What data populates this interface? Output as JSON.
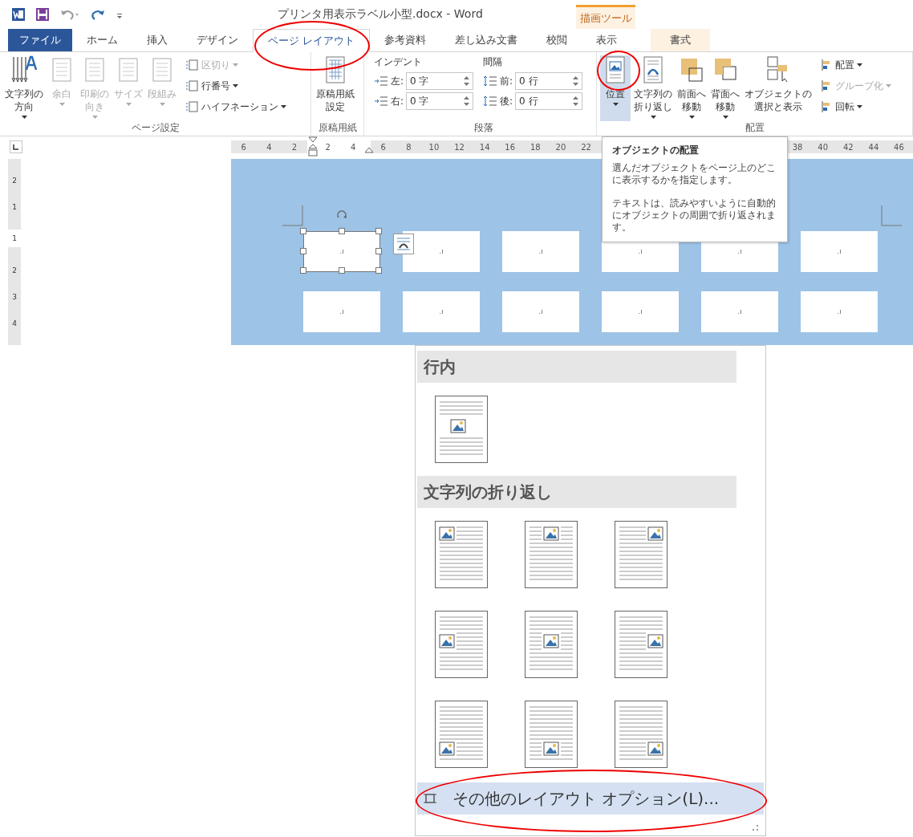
{
  "window": {
    "title": "プリンタ用表示ラベル小型.docx - Word",
    "contextual_group": "描画ツール"
  },
  "tabs": [
    {
      "label": "ファイル",
      "kind": "file",
      "selected": false,
      "circled": false
    },
    {
      "label": "ホーム",
      "kind": "tab",
      "selected": false,
      "circled": false
    },
    {
      "label": "挿入",
      "kind": "tab",
      "selected": false,
      "circled": false
    },
    {
      "label": "デザイン",
      "kind": "tab",
      "selected": false,
      "circled": false
    },
    {
      "label": "ページ レイアウト",
      "kind": "tab",
      "selected": true,
      "circled": true
    },
    {
      "label": "参考資料",
      "kind": "tab",
      "selected": false,
      "circled": false
    },
    {
      "label": "差し込み文書",
      "kind": "tab",
      "selected": false,
      "circled": false
    },
    {
      "label": "校閲",
      "kind": "tab",
      "selected": false,
      "circled": false
    },
    {
      "label": "表示",
      "kind": "tab",
      "selected": false,
      "circled": false
    },
    {
      "label": "書式",
      "kind": "contextual",
      "selected": false,
      "circled": false
    }
  ],
  "ribbon": {
    "page_setup": {
      "title": "ページ設定",
      "big_buttons": [
        {
          "lines": [
            "文字列の",
            "方向"
          ],
          "menu": true,
          "disabled": false
        },
        {
          "lines": [
            "余白"
          ],
          "menu": true,
          "disabled": true
        },
        {
          "lines": [
            "印刷の",
            "向き"
          ],
          "menu": true,
          "disabled": true
        },
        {
          "lines": [
            "サイズ"
          ],
          "menu": true,
          "disabled": true
        },
        {
          "lines": [
            "段組み"
          ],
          "menu": true,
          "disabled": true
        }
      ],
      "small_buttons": [
        {
          "label": "区切り",
          "menu": true,
          "disabled": true
        },
        {
          "label": "行番号",
          "menu": true,
          "disabled": false
        },
        {
          "label": "ハイフネーション",
          "menu": true,
          "disabled": false
        }
      ]
    },
    "manuscript": {
      "title": "原稿用紙",
      "button": {
        "lines": [
          "原稿用紙",
          "設定"
        ]
      }
    },
    "paragraph": {
      "title": "段落",
      "indent_label": "インデント",
      "spacing_label": "間隔",
      "indent": [
        {
          "label": "左:",
          "value": "0 字"
        },
        {
          "label": "右:",
          "value": "0 字"
        }
      ],
      "spacing": [
        {
          "label": "前:",
          "value": "0 行"
        },
        {
          "label": "後:",
          "value": "0 行"
        }
      ]
    },
    "arrange": {
      "title": "配置",
      "big_buttons": [
        {
          "lines": [
            "位置"
          ],
          "menu": true,
          "selected": true,
          "circled": true
        },
        {
          "lines": [
            "文字列の",
            "折り返し"
          ],
          "menu": true,
          "selected": false,
          "circled": false
        },
        {
          "lines": [
            "前面へ",
            "移動"
          ],
          "menu": true,
          "selected": false,
          "circled": false
        },
        {
          "lines": [
            "背面へ",
            "移動"
          ],
          "menu": true,
          "selected": false,
          "circled": false
        },
        {
          "lines": [
            "オブジェクトの",
            "選択と表示"
          ],
          "menu": false,
          "selected": false,
          "circled": false
        }
      ],
      "small_buttons": [
        {
          "label": "配置",
          "menu": true,
          "disabled": false
        },
        {
          "label": "グループ化",
          "menu": true,
          "disabled": true
        },
        {
          "label": "回転",
          "menu": true,
          "disabled": false
        }
      ]
    }
  },
  "ruler": {
    "left_numbers": [
      "6",
      "4",
      "2"
    ],
    "right_numbers": [
      "2",
      "4",
      "6",
      "8",
      "10",
      "12",
      "14",
      "16",
      "18",
      "20",
      "22"
    ],
    "far_numbers": [
      "38",
      "40",
      "42",
      "44",
      "46"
    ],
    "vertical_numbers": [
      "2",
      "1",
      "1",
      "2",
      "3",
      "4"
    ]
  },
  "document": {
    "label_rows": [
      [
        {
          "selected": true,
          "text": ".ı"
        },
        {
          "selected": false,
          "text": ".ı"
        },
        {
          "selected": false,
          "text": ".ı"
        },
        {
          "selected": false,
          "text": ".ı"
        },
        {
          "selected": false,
          "text": ".ı"
        },
        {
          "selected": false,
          "text": ".ı"
        }
      ],
      [
        {
          "selected": false,
          "text": ".ı"
        },
        {
          "selected": false,
          "text": ".ı"
        },
        {
          "selected": false,
          "text": ".ı"
        },
        {
          "selected": false,
          "text": ".ı"
        },
        {
          "selected": false,
          "text": ".ı"
        },
        {
          "selected": false,
          "text": ".ı"
        }
      ]
    ]
  },
  "tooltip": {
    "title": "オブジェクトの配置",
    "paragraphs": [
      "選んだオブジェクトをページ上のどこに表示するかを指定します。",
      "テキストは、読みやすいように自動的にオブジェクトの周囲で折り返されます。"
    ]
  },
  "position_menu": {
    "sections": [
      {
        "title": "行内",
        "options": [
          {
            "kind": "inline"
          }
        ]
      },
      {
        "title": "文字列の折り返し",
        "options": [
          {
            "kind": "topleft"
          },
          {
            "kind": "topcenter"
          },
          {
            "kind": "topright"
          },
          {
            "kind": "middleleft"
          },
          {
            "kind": "middlecenter"
          },
          {
            "kind": "middleright"
          },
          {
            "kind": "bottomleft"
          },
          {
            "kind": "bottomcenter"
          },
          {
            "kind": "bottomright"
          }
        ]
      }
    ],
    "more_item": {
      "label": "その他のレイアウト オプション(L)...",
      "circled": true
    }
  }
}
